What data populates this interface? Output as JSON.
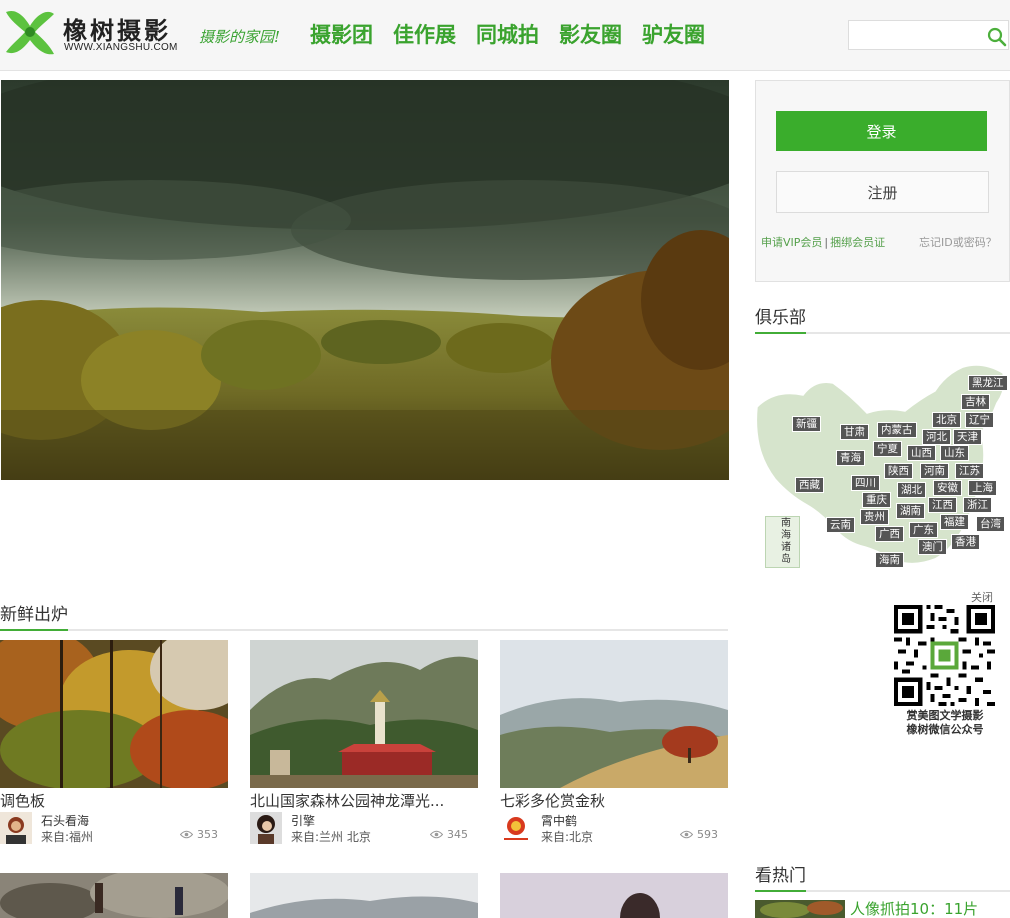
{
  "header": {
    "brand": "橡树摄影",
    "brand_url": "WWW.XIANGSHU.COM",
    "slogan": "摄影的家园!",
    "nav": [
      {
        "label": "摄影团"
      },
      {
        "label": "佳作展"
      },
      {
        "label": "同城拍"
      },
      {
        "label": "影友圈"
      },
      {
        "label": "驴友圈"
      }
    ],
    "search": {
      "value": "",
      "placeholder": ""
    }
  },
  "login": {
    "login_label": "登录",
    "register_label": "注册",
    "apply_vip": "申请VIP会员",
    "separator": "|",
    "bind_card": "捆绑会员证",
    "forgot": "忘记ID或密码？"
  },
  "club": {
    "title": "俱乐部",
    "provinces": [
      "黑龙江",
      "吉林",
      "辽宁",
      "北京",
      "新疆",
      "甘肃",
      "内蒙古",
      "河北",
      "天津",
      "宁夏",
      "青海",
      "山西",
      "山东",
      "陕西",
      "河南",
      "江苏",
      "西藏",
      "四川",
      "湖北",
      "安徽",
      "上海",
      "重庆",
      "江西",
      "浙江",
      "贵州",
      "湖南",
      "福建",
      "台湾",
      "云南",
      "广西",
      "广东",
      "香港",
      "澳门",
      "海南"
    ],
    "south_sea": "南海诸岛"
  },
  "qr": {
    "close": "关闭",
    "caption_line1": "赏美图文学摄影",
    "caption_line2": "橡树微信公众号"
  },
  "fresh": {
    "title": "新鲜出炉",
    "cards": [
      {
        "title": "调色板",
        "author": "石头看海",
        "location": "来自:福州",
        "views": "353"
      },
      {
        "title": "北山国家森林公园神龙潭光...",
        "author": "引擎",
        "location": "来自:兰州 北京",
        "views": "345"
      },
      {
        "title": "七彩多伦赏金秋",
        "author": "霄中鹤",
        "location": "来自:北京",
        "views": "593"
      }
    ]
  },
  "hot": {
    "title": "看热门",
    "first": "人像抓拍10：11片"
  },
  "colors": {
    "brand_green": "#3aa32e",
    "button_green": "#3aad2c",
    "map_fill": "#d6e4cc",
    "label_bg": "#555555"
  }
}
